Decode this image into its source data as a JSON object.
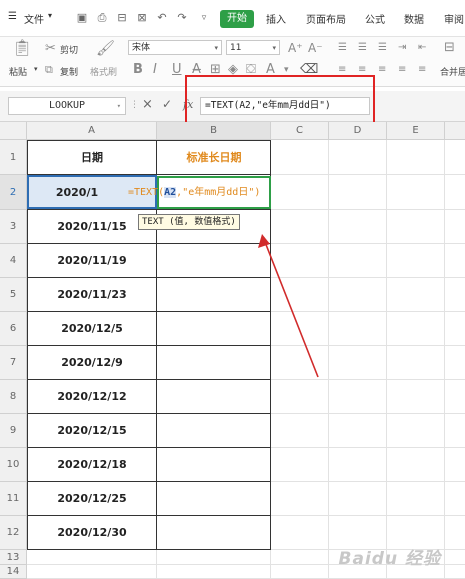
{
  "menubar": {
    "menu_label": "文件",
    "tabs": [
      "开始",
      "插入",
      "页面布局",
      "公式",
      "数据",
      "审阅"
    ]
  },
  "ribbon": {
    "paste_label": "粘贴",
    "cut_label": "剪切",
    "copy_label": "复制",
    "format_painter_label": "格式刷",
    "font_name": "宋体",
    "font_size": "11",
    "merge_label": "合并居"
  },
  "formula_bar": {
    "name_box": "LOOKUP",
    "fx_label": "fx",
    "formula": "=TEXT(A2,\"e年mm月dd日\")"
  },
  "columns": [
    "A",
    "B",
    "C",
    "D",
    "E"
  ],
  "rows": [
    "1",
    "2",
    "3",
    "4",
    "5",
    "6",
    "7",
    "8",
    "9",
    "10",
    "11",
    "12",
    "13",
    "14"
  ],
  "table": {
    "header_a": "日期",
    "header_b": "标准长日期",
    "dates": [
      "2020/1",
      "2020/11/15",
      "2020/11/19",
      "2020/11/23",
      "2020/12/5",
      "2020/12/9",
      "2020/12/12",
      "2020/12/15",
      "2020/12/18",
      "2020/12/25",
      "2020/12/30"
    ]
  },
  "editing": {
    "prefix": "=TEXT(",
    "ref": "A2",
    "suffix": ",\"e年mm月dd日\")",
    "tooltip": "TEXT (值, 数值格式)"
  },
  "watermark": "Baidu 经验",
  "colors": {
    "accent": "#2e9f47",
    "highlight": "#e02424",
    "orange": "#e08a1e"
  }
}
